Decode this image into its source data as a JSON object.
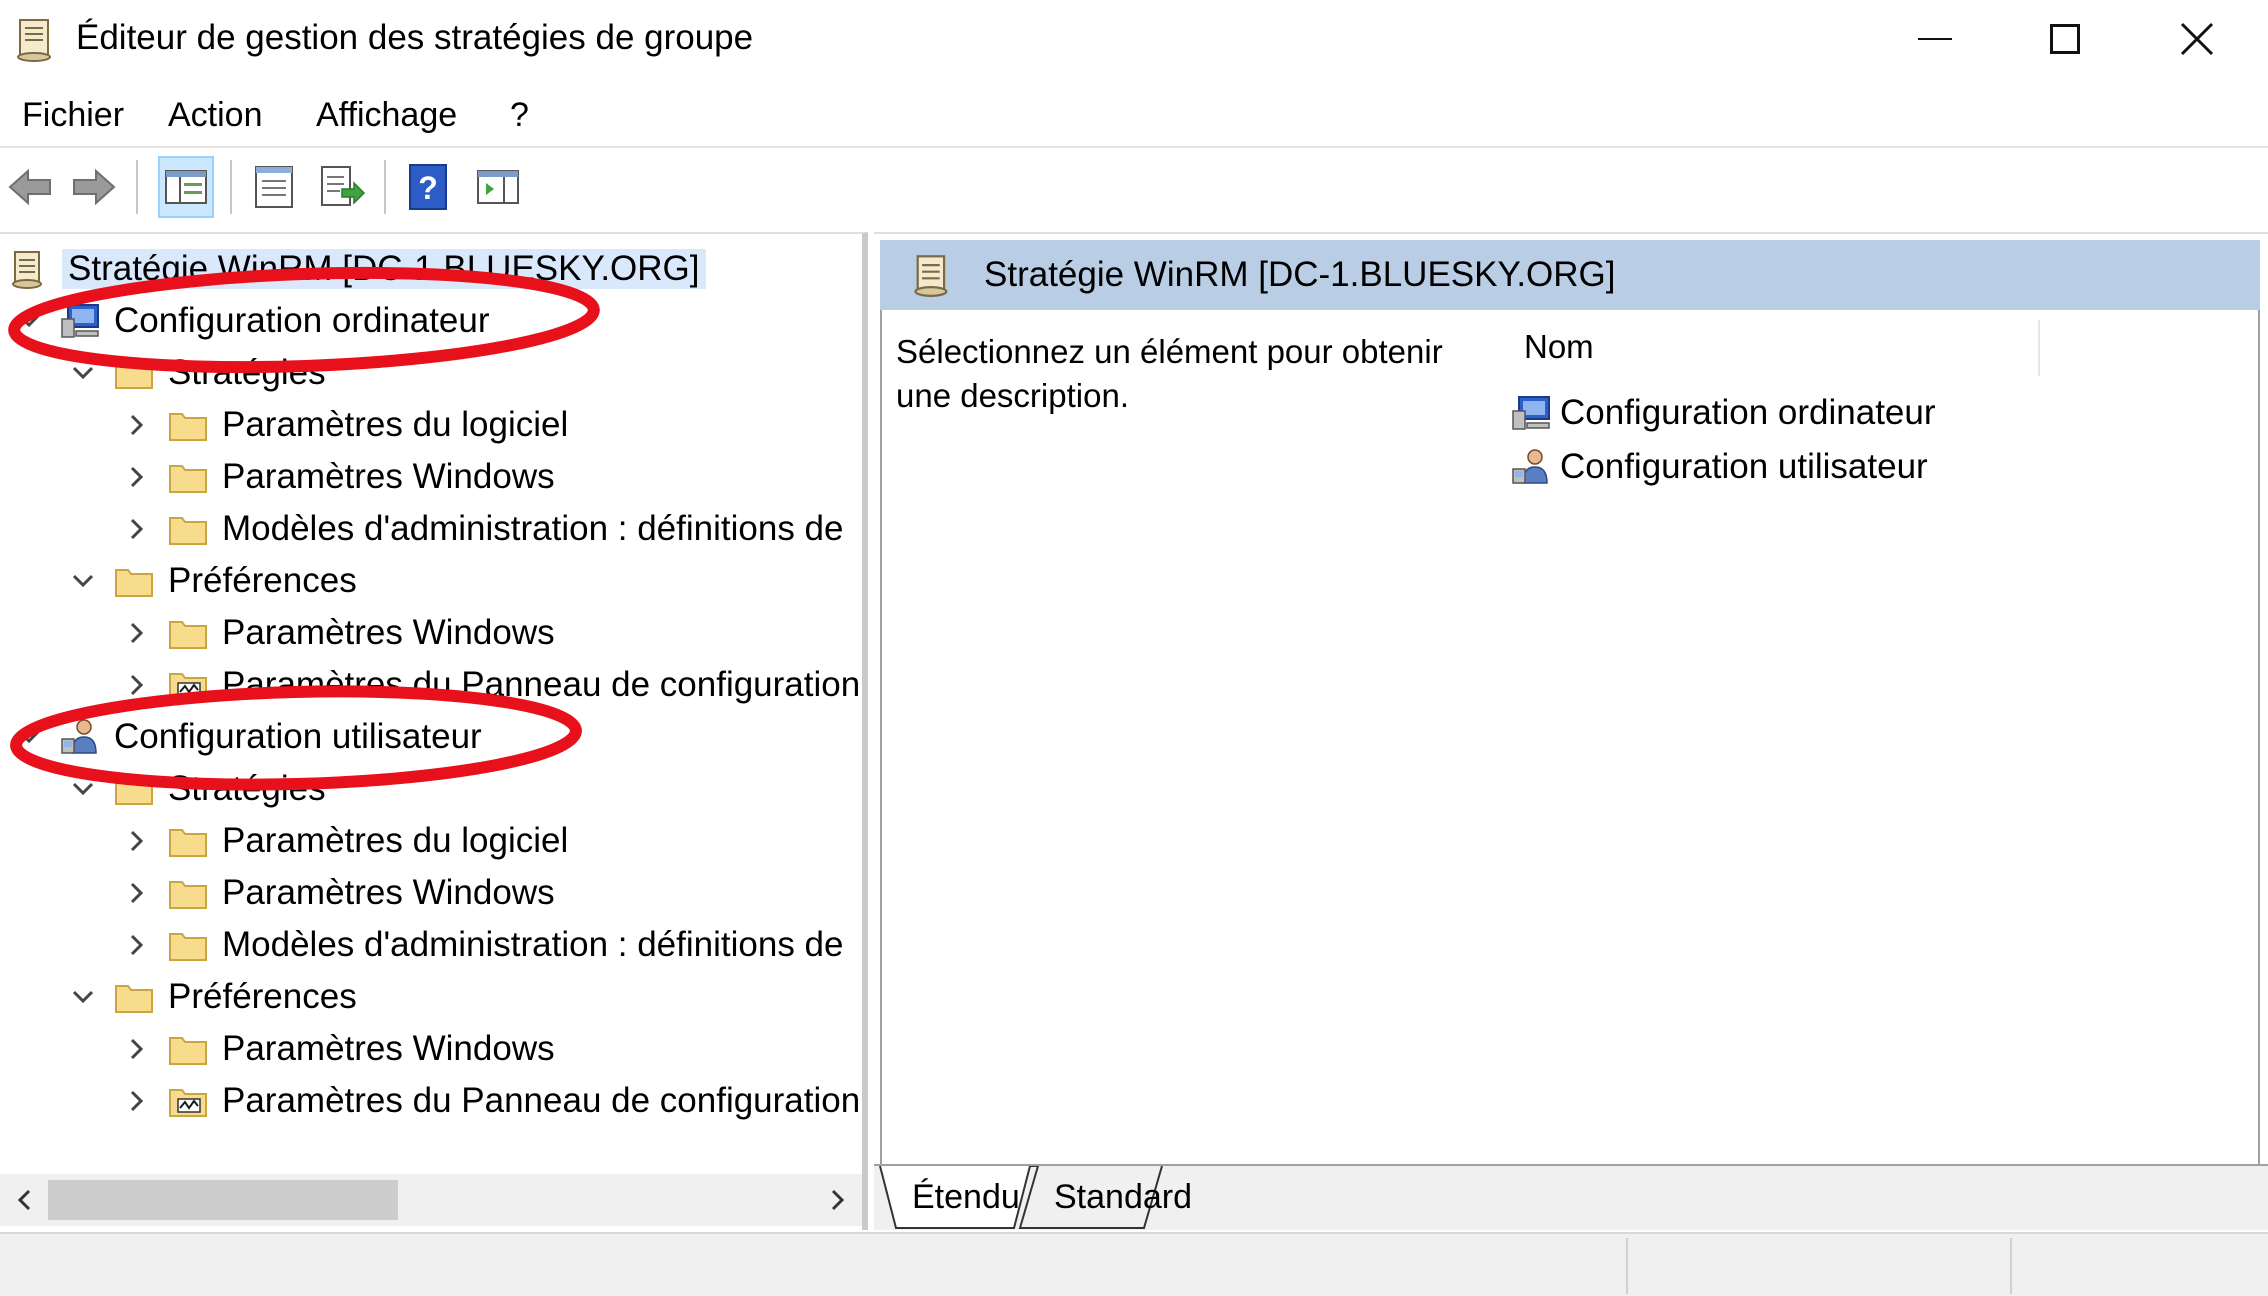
{
  "window": {
    "title": "Éditeur de gestion des stratégies de groupe"
  },
  "menu": [
    "Fichier",
    "Action",
    "Affichage",
    "?"
  ],
  "tree": {
    "root": "Stratégie WinRM [DC-1.BLUESKY.ORG]",
    "computer": {
      "label": "Configuration ordinateur",
      "policies": {
        "label": "Stratégies",
        "children": [
          "Paramètres du logiciel",
          "Paramètres Windows",
          "Modèles d'administration : définitions de"
        ]
      },
      "preferences": {
        "label": "Préférences",
        "children": [
          "Paramètres Windows",
          "Paramètres du Panneau de configuration"
        ]
      }
    },
    "user": {
      "label": "Configuration utilisateur",
      "policies": {
        "label": "Stratégies",
        "children": [
          "Paramètres du logiciel",
          "Paramètres Windows",
          "Modèles d'administration : définitions de"
        ]
      },
      "preferences": {
        "label": "Préférences",
        "children": [
          "Paramètres Windows",
          "Paramètres du Panneau de configuration"
        ]
      }
    }
  },
  "right": {
    "header": "Stratégie WinRM [DC-1.BLUESKY.ORG]",
    "description": "Sélectionnez un élément pour obtenir une description.",
    "column": "Nom",
    "items": [
      "Configuration ordinateur",
      "Configuration utilisateur"
    ]
  },
  "tabs": [
    "Étendu",
    "Standard"
  ],
  "colors": {
    "annotation": "#e8101a",
    "header_bg": "#b9cde5",
    "selection": "#d9e8fb"
  }
}
